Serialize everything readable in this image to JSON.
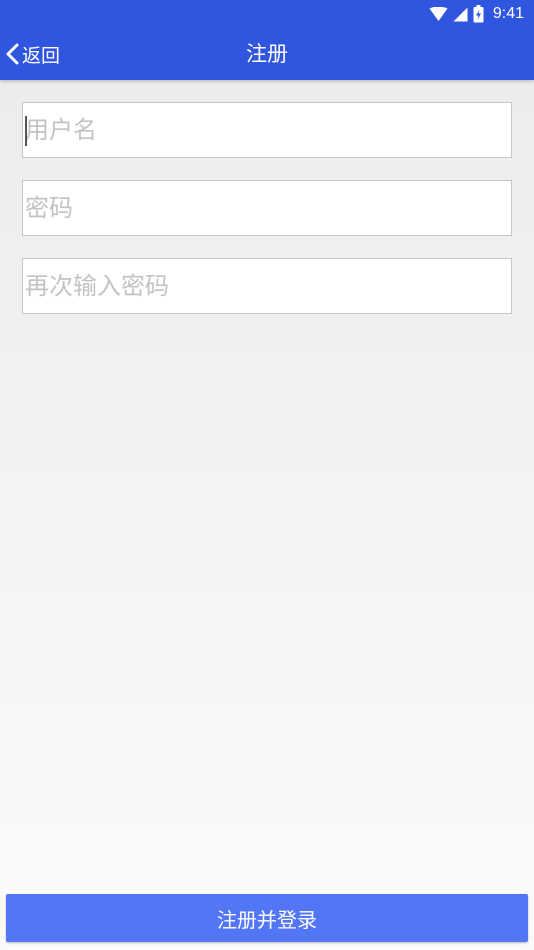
{
  "status_bar": {
    "time": "9:41",
    "icons": [
      "wifi-icon",
      "signal-icon",
      "battery-icon"
    ]
  },
  "header": {
    "back_label": "返回",
    "title": "注册"
  },
  "form": {
    "username_placeholder": "用户名",
    "password_placeholder": "密码",
    "confirm_placeholder": "再次输入密码"
  },
  "submit": {
    "label": "注册并登录"
  },
  "colors": {
    "header": "#3056e0",
    "button": "#5376f6",
    "placeholder": "#c3c3c3"
  }
}
